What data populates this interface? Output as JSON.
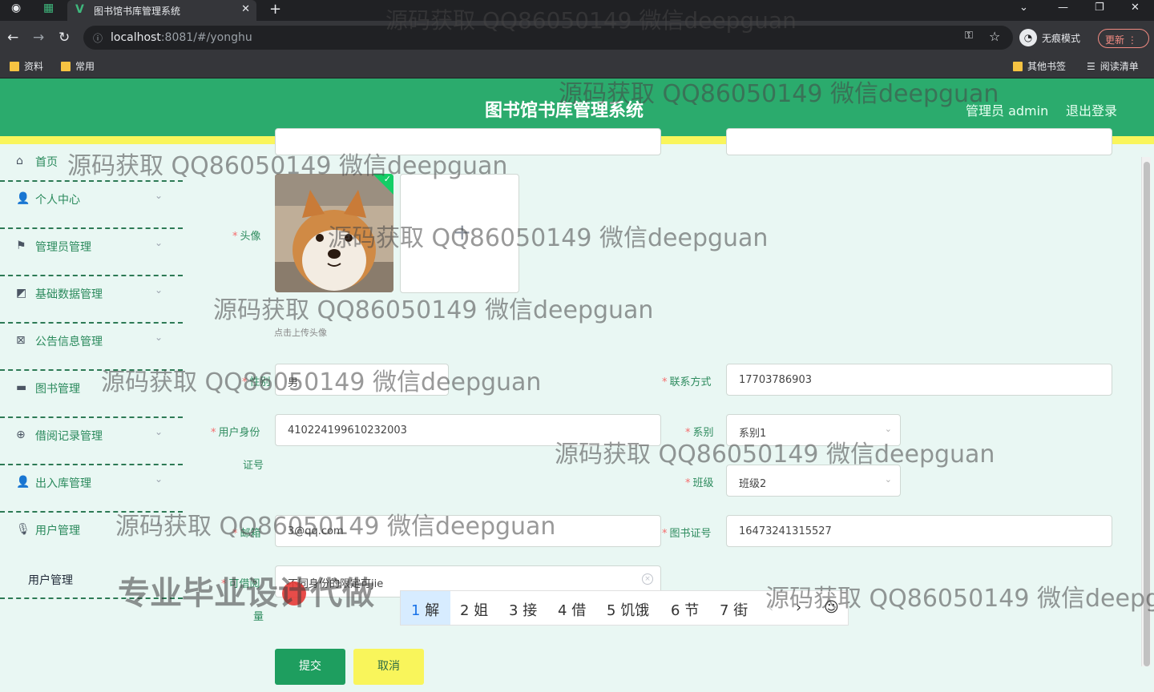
{
  "browser": {
    "tab_title": "图书馆书库管理系统",
    "url_host": "localhost",
    "url_rest": ":8081/#/yonghu",
    "incognito_label": "无痕模式",
    "update_label": "更新",
    "bookmarks": [
      "资料",
      "常用",
      "其他书签",
      "阅读清单"
    ]
  },
  "header": {
    "title": "图书馆书库管理系统",
    "admin": "管理员 admin",
    "logout": "退出登录"
  },
  "sidebar": {
    "items": [
      {
        "label": "首页",
        "icon": "home-icon"
      },
      {
        "label": "个人中心",
        "icon": "user-icon"
      },
      {
        "label": "管理员管理",
        "icon": "flag-icon"
      },
      {
        "label": "基础数据管理",
        "icon": "chart-icon"
      },
      {
        "label": "公告信息管理",
        "icon": "notice-icon"
      },
      {
        "label": "图书管理",
        "icon": "briefcase-icon"
      },
      {
        "label": "借阅记录管理",
        "icon": "globe-icon"
      },
      {
        "label": "出入库管理",
        "icon": "user-icon"
      },
      {
        "label": "用户管理",
        "icon": "mic-icon"
      }
    ],
    "sub_item": "用户管理"
  },
  "form": {
    "avatar_label": "头像",
    "upload_hint": "点击上传头像",
    "gender_label": "性别",
    "gender_value": "男",
    "contact_label": "联系方式",
    "contact_value": "17703786903",
    "idcard_label_1": "用户身份",
    "idcard_label_2": "证号",
    "idcard_value": "410224199610232003",
    "dept_label": "系别",
    "dept_value": "系别1",
    "class_label": "班级",
    "class_value": "班级2",
    "email_label": "邮箱",
    "email_value": "3@qq.com",
    "card_label": "图书证号",
    "card_value": "16473241315527",
    "quota_label_1": "可借阅",
    "quota_label_2": "量",
    "quota_value": "不同身份的限定可jie",
    "submit": "提交",
    "cancel": "取消"
  },
  "ime": {
    "candidates": [
      "解",
      "姐",
      "接",
      "借",
      "饥饿",
      "节",
      "街"
    ]
  },
  "watermarks": {
    "main": "源码获取 QQ86050149 微信deepguan",
    "cut": "源码获取 QQ86050149 微信deepgu",
    "promo": "专业毕业设计代做"
  }
}
